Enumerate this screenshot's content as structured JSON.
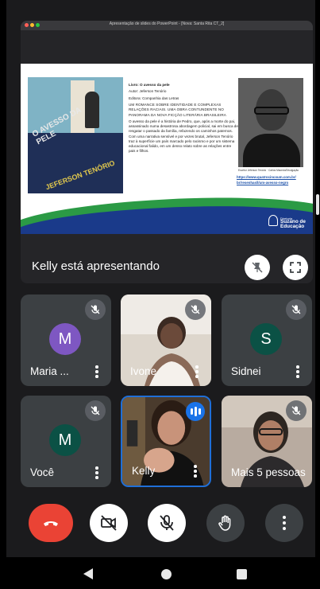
{
  "presentation": {
    "window_title": "Apresentação de slides do PowerPoint - [Nova: Santa Rita CT_2]",
    "presenter_status": "Kelly está apresentando",
    "slide": {
      "book_title": "O AVESSO DA PELE",
      "book_author": "JEFERSON TENÓRIO",
      "book_line": "Livro: O avesso da pele",
      "author_line": "Autor: Jeferson Tenório",
      "publisher_line": "Editora: Companhia das Letras",
      "summary_caps": "UM ROMANCE SOBRE IDENTIDADE E COMPLEXAS RELAÇÕES RACIAIS. UMA OBRA CONTUNDENTE NO PANORAMA DA NOVA FICÇÃO LITERÁRIA BRASILEIRA",
      "summary": "O avesso da pele é a história de Pedro, que, após a morte do pai, assassinado numa desastrosa abordagem policial, sai em busca de resgatar o passado da família, refazendo os caminhos paternos. Com uma narrativa sensível e por vezes brutal, Jeferson Tenório traz à superfície um país marcado pelo racismo e por um sistema educacional falido, em um denso relato sobre as relações entre pais e filhos.",
      "photo_caption": "Escritor Jeferson Tenório · Carlos Macedo/Divulgação",
      "link1": "https://www.quatrocincoum.com.br/",
      "link2": "br/resenhas/l/um-avesso-negro",
      "logo_small": "Diretoria",
      "logo_line1": "Suzano de",
      "logo_line2": "Educação"
    }
  },
  "participants": [
    {
      "name": "Maria ...",
      "initial": "M",
      "avatar_color": "#7e57c2",
      "muted": true
    },
    {
      "name": "Ivone",
      "initial": "",
      "muted": true
    },
    {
      "name": "Sidnei",
      "initial": "S",
      "avatar_color": "#0b5145",
      "muted": true
    },
    {
      "name": "Você",
      "initial": "M",
      "avatar_color": "#0b5145",
      "muted": true
    },
    {
      "name": "Kelly",
      "initial": "",
      "speaking": true
    },
    {
      "name": "Mais 5 pessoas",
      "initial": "",
      "muted": true
    }
  ],
  "controls": [
    "end-call",
    "camera-off",
    "mic-off",
    "raise-hand",
    "more-options"
  ],
  "colors": {
    "end_call": "#ea4335",
    "active_border": "#1f6fd8",
    "tile_bg": "#3c4043"
  }
}
